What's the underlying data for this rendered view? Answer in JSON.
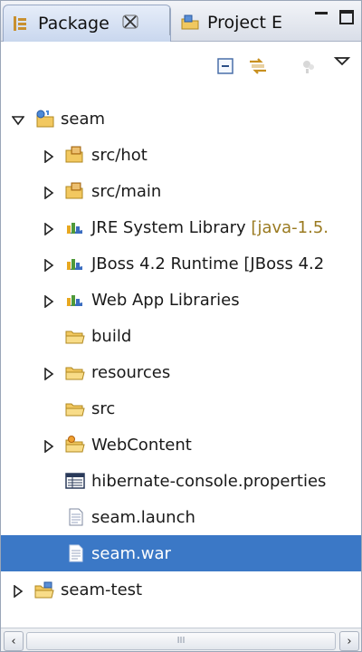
{
  "tabs": {
    "active_label": "Package",
    "close_glyph": "〈",
    "inactive_label": "Project E"
  },
  "toolbar": {
    "buttons": [
      "collapse-all-icon",
      "link-with-editor-icon",
      "filters-icon",
      "view-menu-icon"
    ]
  },
  "tree": {
    "items": [
      {
        "label": "seam",
        "decoration": "",
        "icon": "java-project-icon",
        "expanded": true
      },
      {
        "label": "src/hot",
        "decoration": "",
        "icon": "source-folder-icon",
        "expanded": false
      },
      {
        "label": "src/main",
        "decoration": "",
        "icon": "source-folder-icon",
        "expanded": false
      },
      {
        "label": "JRE System Library ",
        "decoration": "[java-1.5.",
        "icon": "library-icon",
        "expanded": false
      },
      {
        "label": "JBoss 4.2 Runtime [JBoss 4.2",
        "decoration": "",
        "icon": "library-icon",
        "expanded": false
      },
      {
        "label": "Web App Libraries",
        "decoration": "",
        "icon": "library-icon",
        "expanded": false
      },
      {
        "label": "build",
        "decoration": "",
        "icon": "folder-icon",
        "expanded": null
      },
      {
        "label": "resources",
        "decoration": "",
        "icon": "folder-icon",
        "expanded": false
      },
      {
        "label": "src",
        "decoration": "",
        "icon": "folder-icon",
        "expanded": null
      },
      {
        "label": "WebContent",
        "decoration": "",
        "icon": "web-folder-icon",
        "expanded": false
      },
      {
        "label": "hibernate-console.properties",
        "decoration": "",
        "icon": "properties-file-icon",
        "expanded": null
      },
      {
        "label": "seam.launch",
        "decoration": "",
        "icon": "file-icon",
        "expanded": null
      },
      {
        "label": "seam.war",
        "decoration": "",
        "icon": "file-icon",
        "expanded": null,
        "selected": true
      },
      {
        "label": "seam-test",
        "decoration": "",
        "icon": "java-project-icon",
        "expanded": false
      }
    ]
  },
  "scrollbar": {
    "thumb_grip": "III",
    "left_arrow": "‹",
    "right_arrow": "›"
  },
  "colors": {
    "selection": "#3b78c6",
    "decoration_text": "#9a7a20",
    "tab_active": "#c9d7ee"
  }
}
